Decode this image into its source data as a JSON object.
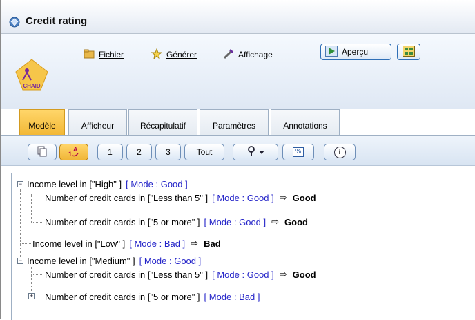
{
  "window": {
    "title": "Credit rating",
    "node_icon_label": "CHAID"
  },
  "menu": {
    "fichier": "Fichier",
    "generer": "Générer",
    "affichage": "Affichage",
    "apercu": "Aperçu"
  },
  "tabs": [
    {
      "label": "Modèle",
      "active": true
    },
    {
      "label": "Afficheur",
      "active": false
    },
    {
      "label": "Récapitulatif",
      "active": false
    },
    {
      "label": "Paramètres",
      "active": false
    },
    {
      "label": "Annotations",
      "active": false
    }
  ],
  "toolbar2": {
    "level1": "1",
    "level2": "2",
    "level3": "3",
    "all": "Tout",
    "percent": "%",
    "info": "i"
  },
  "tree": [
    {
      "text": "Income level in [\"High\" ]",
      "mode": "[ Mode : Good ]",
      "prediction": "",
      "expander": "minus"
    },
    {
      "text": "Number of credit cards in [\"Less than 5\" ]",
      "mode": "[ Mode : Good ]",
      "prediction": "Good",
      "expander": ""
    },
    {
      "text": "Number of credit cards in [\"5 or more\" ]",
      "mode": "[ Mode : Good ]",
      "prediction": "Good",
      "expander": ""
    },
    {
      "text": "Income level in [\"Low\" ]",
      "mode": "[ Mode : Bad ]",
      "prediction": "Bad",
      "expander": ""
    },
    {
      "text": "Income level in [\"Medium\" ]",
      "mode": "[ Mode : Good ]",
      "prediction": "",
      "expander": "minus"
    },
    {
      "text": "Number of credit cards in [\"Less than 5\" ]",
      "mode": "[ Mode : Good ]",
      "prediction": "Good",
      "expander": ""
    },
    {
      "text": "Number of credit cards in [\"5 or more\" ]",
      "mode": "[ Mode : Bad ]",
      "prediction": "",
      "expander": "plus"
    }
  ],
  "arrow_glyph": "⇨",
  "colors": {
    "mode_text": "#2323c8",
    "active_tab": "#f2b735",
    "button_border": "#2f6fb6"
  }
}
